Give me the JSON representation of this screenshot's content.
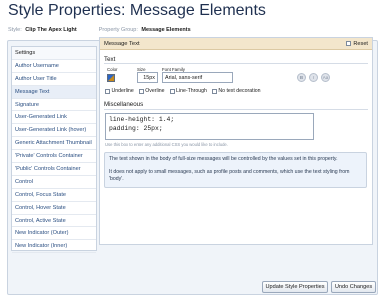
{
  "page": {
    "title": "Style Properties: Message Elements"
  },
  "sub_bar": {
    "style_label": "Style:",
    "style_value": "Clip The Apex Light",
    "group_label": "Property Group:",
    "group_value": "Message Elements"
  },
  "sidebar": {
    "items": [
      "Settings",
      "Author Username",
      "Author User Title",
      "Message Text",
      "Signature",
      "User-Generated Link",
      "User-Generated Link (hover)",
      "Generic Attachment Thumbnail",
      "'Private' Controls Container",
      "'Public' Controls Container",
      "Control",
      "Control, Focus State",
      "Control, Hover State",
      "Control, Active State",
      "New Indicator (Outer)",
      "New Indicator (Inner)"
    ],
    "active_index": 3
  },
  "panel": {
    "title": "Message Text",
    "reset_label": "Reset",
    "text_section": {
      "title": "Text",
      "color_label": "Color",
      "size_label": "Size",
      "font_family_label": "Font Family",
      "size_value": "15px",
      "font_family_value": "Arial, sans-serif",
      "bold_glyph": "B",
      "italic_glyph": "I",
      "case_glyph": "Aa",
      "swatch_colors": [
        "#2b66c7",
        "#c98a1a"
      ],
      "checks": [
        "Underline",
        "Overline",
        "Line-Through",
        "No text decoration"
      ]
    },
    "misc_section": {
      "title": "Miscellaneous",
      "css_value": "line-height: 1.4;\npadding: 25px;",
      "hint": "Use this box to enter any additional CSS you would like to include."
    },
    "info": {
      "line1": "The text shown in the body of full-size messages will be controlled by the values set in this property.",
      "line2": "It does not apply to small messages, such as profile posts and comments, which use the text styling from 'body'."
    }
  },
  "buttons": {
    "update": "Update Style Properties",
    "undo": "Undo Changes"
  }
}
